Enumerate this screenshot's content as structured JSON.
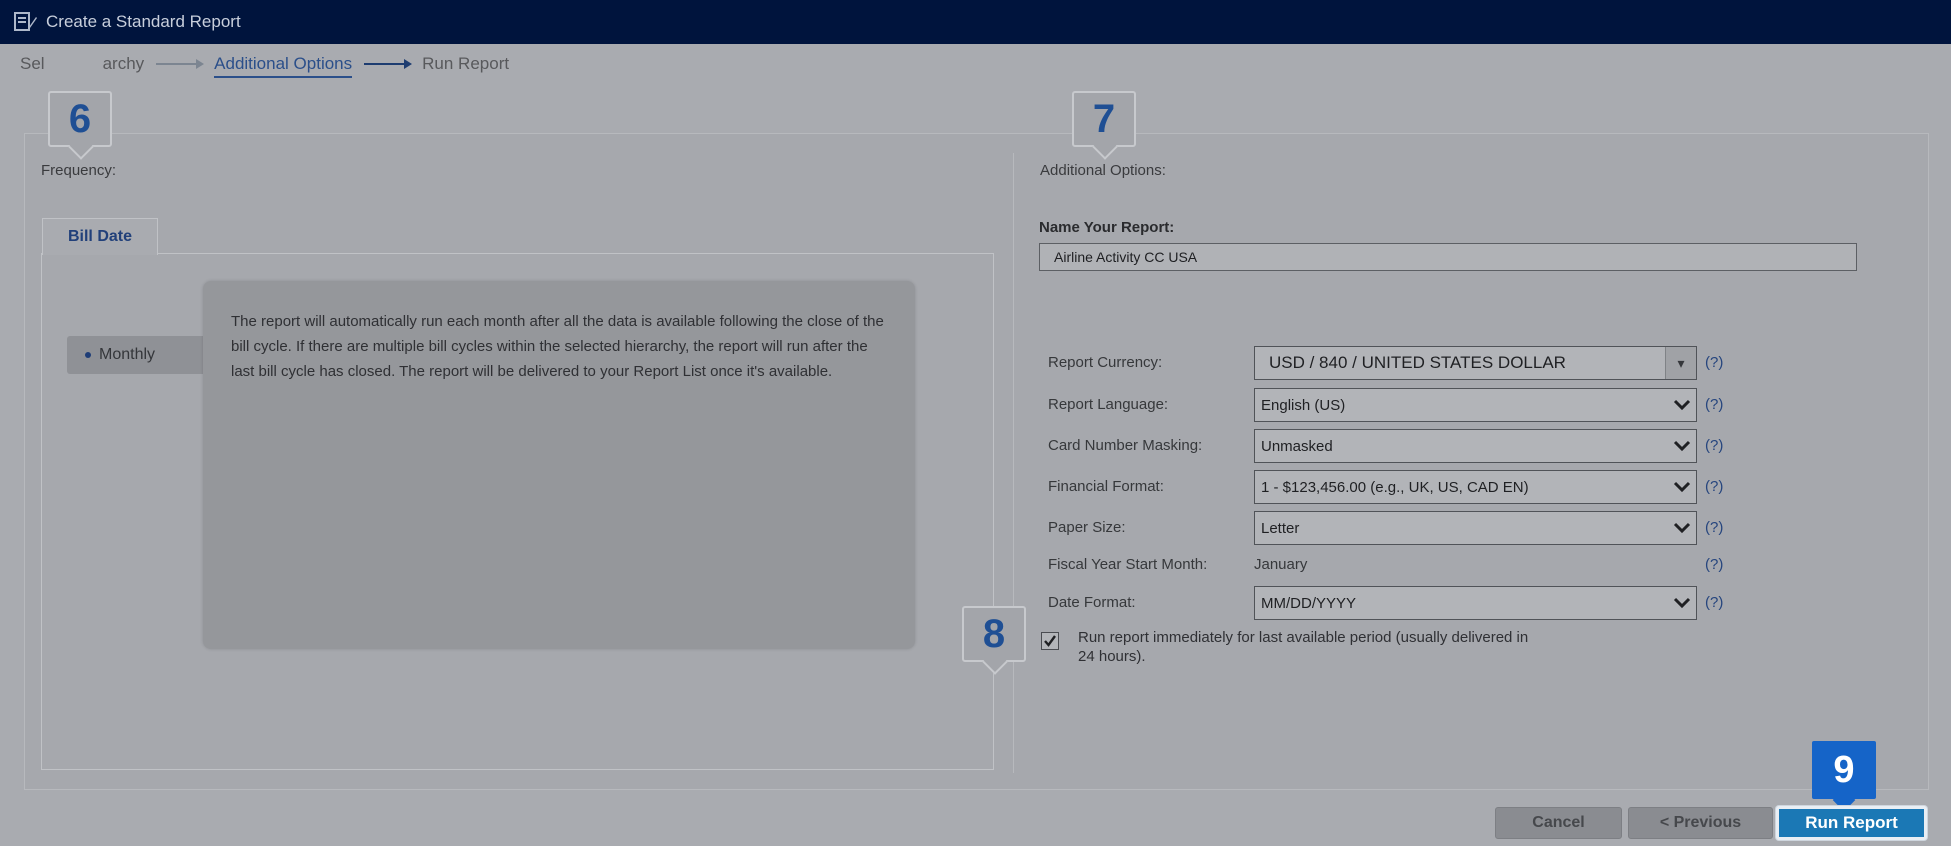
{
  "window": {
    "title": "Create a Standard Report"
  },
  "stepper": {
    "steps": [
      "Select Hierarchy",
      "Additional Options",
      "Run Report"
    ],
    "visible_step1": "Sel",
    "visible_step1_tail": "archy"
  },
  "left": {
    "heading": "Frequency:",
    "tab_label": "Bill Date",
    "radio_label": "Monthly",
    "info_text": "The report will automatically run each month after all the data is available following the close of the bill cycle. If there are multiple bill cycles within the selected hierarchy, the report will run after the last bill cycle has closed. The report will be delivered to your Report List once it's available."
  },
  "right": {
    "heading": "Additional Options:",
    "name_label": "Name Your Report:",
    "name_value": "Airline Activity CC USA",
    "help": "(?)",
    "fields": {
      "currency": {
        "label": "Report Currency:",
        "value": "USD / 840 / UNITED STATES DOLLAR"
      },
      "language": {
        "label": "Report Language:",
        "value": "English (US)"
      },
      "masking": {
        "label": "Card Number Masking:",
        "value": "Unmasked"
      },
      "financial": {
        "label": "Financial Format:",
        "value": "1 - $123,456.00 (e.g., UK, US, CAD EN)"
      },
      "paper": {
        "label": "Paper Size:",
        "value": "Letter"
      },
      "fiscal": {
        "label": "Fiscal Year Start Month:",
        "value": "January"
      },
      "date": {
        "label": "Date Format:",
        "value": "MM/DD/YYYY"
      }
    },
    "run_now_label": "Run report immediately for last available period (usually delivered in 24 hours).",
    "run_now_checked": true
  },
  "badges": {
    "b6": "6",
    "b7": "7",
    "b8": "8",
    "b9": "9"
  },
  "buttons": {
    "cancel": "Cancel",
    "previous": "< Previous",
    "run": "Run Report"
  },
  "colors": {
    "title_bar": "#00143d",
    "accent": "#1b78b5",
    "badge_blue": "#1564c8"
  }
}
